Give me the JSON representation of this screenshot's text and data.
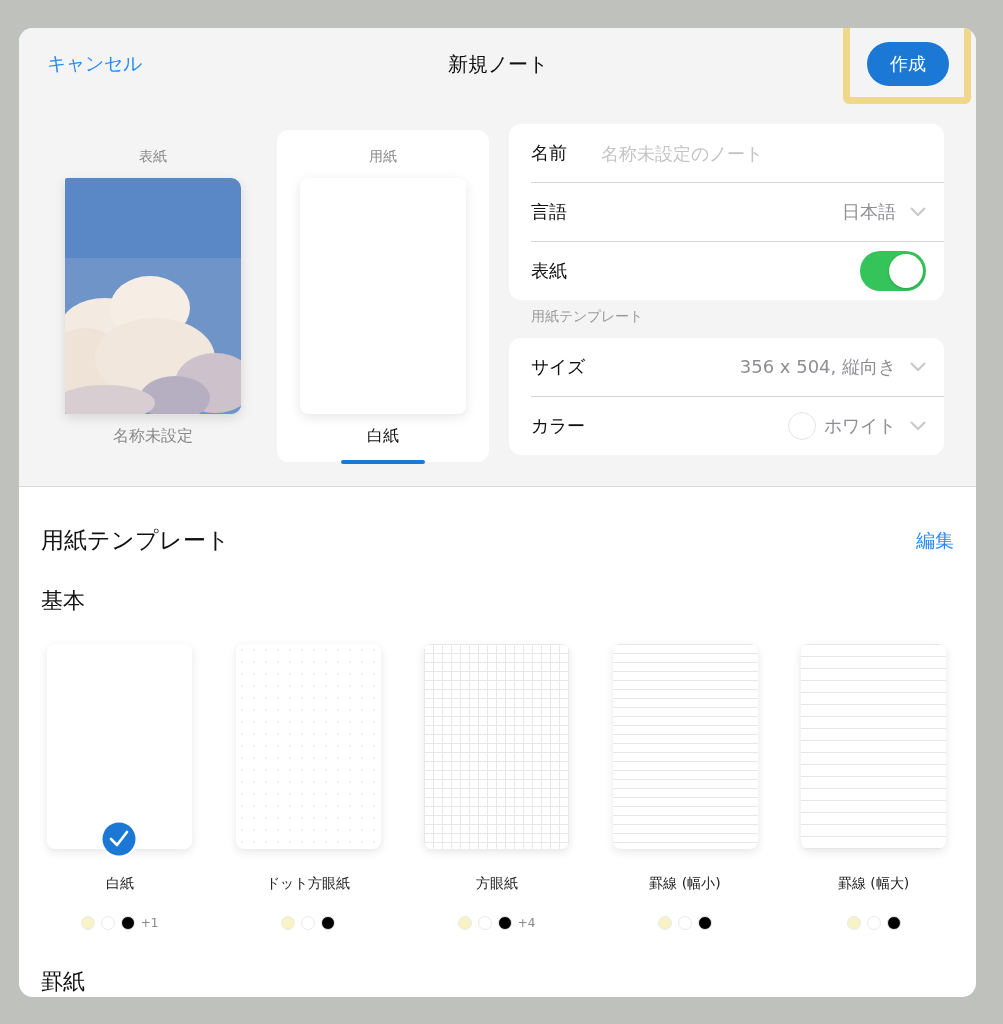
{
  "header": {
    "cancel": "キャンセル",
    "title": "新規ノート",
    "create": "作成",
    "create_highlighted": true
  },
  "selector": [
    {
      "label": "表紙",
      "caption": "名称未設定",
      "kind": "cover",
      "selected": false
    },
    {
      "label": "用紙",
      "caption": "白紙",
      "kind": "paper",
      "selected": true
    }
  ],
  "settings": {
    "name": {
      "label": "名前",
      "placeholder": "名称未設定のノート"
    },
    "language": {
      "label": "言語",
      "value": "日本語"
    },
    "cover": {
      "label": "表紙",
      "on": true
    },
    "section_label": "用紙テンプレート",
    "size": {
      "label": "サイズ",
      "value": "356 x 504, 縦向き"
    },
    "color": {
      "label": "カラー",
      "value": "ホワイト",
      "color": "#ffffff"
    }
  },
  "templates": {
    "title": "用紙テンプレート",
    "edit": "編集",
    "group": "基本",
    "items": [
      {
        "name": "白紙",
        "kind": "blank",
        "selected": true,
        "swatches": [
          {
            "color": "#f7f3c6"
          },
          {
            "color": "#ffffff"
          },
          {
            "color": "#000000"
          }
        ],
        "extra": "+1"
      },
      {
        "name": "ドット方眼紙",
        "kind": "dot",
        "selected": false,
        "swatches": [
          {
            "color": "#f7f3c6"
          },
          {
            "color": "#ffffff"
          },
          {
            "color": "#000000"
          }
        ]
      },
      {
        "name": "方眼紙",
        "kind": "grid",
        "selected": false,
        "swatches": [
          {
            "color": "#f7f3c6"
          },
          {
            "color": "#ffffff"
          },
          {
            "color": "#000000"
          }
        ],
        "extra": "+4"
      },
      {
        "name": "罫線 (幅小)",
        "kind": "ruled-narrow",
        "selected": false,
        "swatches": [
          {
            "color": "#f7f3c6"
          },
          {
            "color": "#ffffff"
          },
          {
            "color": "#000000"
          }
        ]
      },
      {
        "name": "罫線 (幅大)",
        "kind": "ruled-wide",
        "selected": false,
        "swatches": [
          {
            "color": "#f7f3c6"
          },
          {
            "color": "#ffffff"
          },
          {
            "color": "#000000"
          }
        ]
      }
    ],
    "next_group": "罫紙"
  }
}
